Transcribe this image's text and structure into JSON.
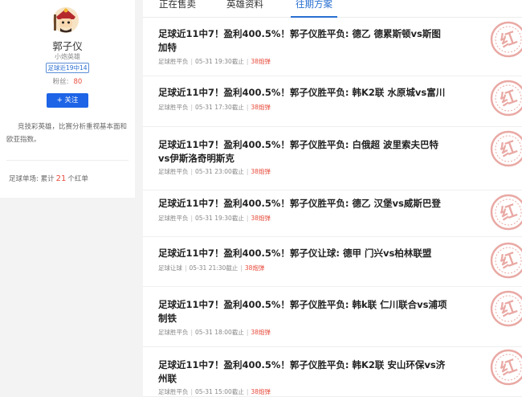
{
  "profile": {
    "username": "郭子仪",
    "title": "小炮英雄",
    "record_badge": "足球近19中14",
    "fans_label": "粉丝:",
    "fans_count": "80",
    "follow_label": "+ 关注",
    "description": "竞技彩英雄，比赛分析重视基本面和欧亚指数。",
    "stat_prefix": "足球单场: 累计",
    "stat_count": "21",
    "stat_suffix": "个红单"
  },
  "tabs": [
    {
      "label": "正在售卖",
      "active": false
    },
    {
      "label": "英雄资料",
      "active": false
    },
    {
      "label": "往期方案",
      "active": true
    }
  ],
  "items": [
    {
      "title": "足球近11中7！盈利400.5%！郭子仪胜平负: 德乙 德累斯顿vs斯图加特",
      "type": "足球胜平负",
      "date": "05-31 19:30截止",
      "price": "38炮弹"
    },
    {
      "title": "足球近11中7！盈利400.5%！郭子仪胜平负: 韩K2联 水原城vs富川",
      "type": "足球胜平负",
      "date": "05-31 17:30截止",
      "price": "38炮弹"
    },
    {
      "title": "足球近11中7！盈利400.5%！郭子仪胜平负: 白俄超 波里索夫巴特vs伊斯洛奇明斯克",
      "type": "足球胜平负",
      "date": "05-31 23:00截止",
      "price": "38炮弹"
    },
    {
      "title": "足球近11中7！盈利400.5%！郭子仪胜平负: 德乙 汉堡vs威斯巴登",
      "type": "足球胜平负",
      "date": "05-31 19:30截止",
      "price": "38炮弹"
    },
    {
      "title": "足球近11中7！盈利400.5%！郭子仪让球: 德甲 门兴vs柏林联盟",
      "type": "足球让球",
      "date": "05-31 21:30截止",
      "price": "38炮弹"
    },
    {
      "title": "足球近11中7！盈利400.5%！郭子仪胜平负: 韩k联 仁川联合vs浦项制铁",
      "type": "足球胜平负",
      "date": "05-31 18:00截止",
      "price": "38炮弹"
    },
    {
      "title": "足球近11中7！盈利400.5%！郭子仪胜平负: 韩K2联 安山环保vs济州联",
      "type": "足球胜平负",
      "date": "05-31 15:00截止",
      "price": "38炮弹"
    }
  ],
  "stamp_text": "红",
  "colors": {
    "accent_blue": "#2a6fd1",
    "button_blue": "#1d64e6",
    "red": "#e74c3c",
    "stamp_red": "#e9a9a4"
  },
  "icons": {
    "avatar": "warrior-avatar-icon",
    "stamp": "red-win-stamp-icon"
  }
}
